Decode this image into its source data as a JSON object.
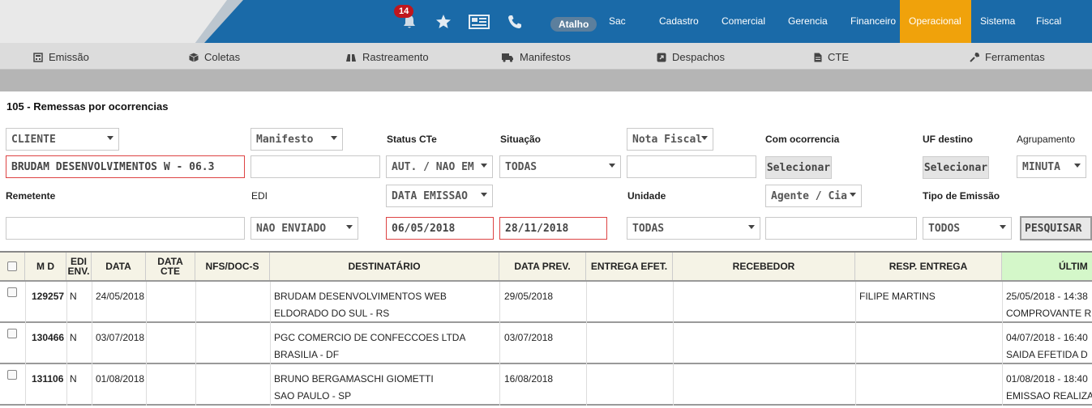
{
  "header": {
    "notification_count": "14",
    "atalho_label": "Atalho",
    "nav": [
      {
        "label": "Sac"
      },
      {
        "label": "Cadastro"
      },
      {
        "label": "Comercial"
      },
      {
        "label": "Gerencia"
      },
      {
        "label": "Financeiro"
      },
      {
        "label": "Operacional",
        "active": true
      },
      {
        "label": "Sistema"
      },
      {
        "label": "Fiscal"
      }
    ],
    "accent_color": "#f0a20b",
    "bar_color": "#1a6aa8"
  },
  "subnav": {
    "items": [
      {
        "label": "Emissão",
        "icon": "calculator-icon"
      },
      {
        "label": "Coletas",
        "icon": "box-icon"
      },
      {
        "label": "Rastreamento",
        "icon": "binoculars-icon"
      },
      {
        "label": "Manifestos",
        "icon": "truck-icon"
      },
      {
        "label": "Despachos",
        "icon": "external-link-icon"
      },
      {
        "label": "CTE",
        "icon": "file-icon"
      },
      {
        "label": "Ferramentas",
        "icon": "wrench-icon"
      }
    ]
  },
  "form": {
    "title": "105 - Remessas por ocorrencias",
    "cliente_select": "CLIENTE",
    "cliente_value": "BRUDAM DESENVOLVIMENTOS W - 06.3",
    "manifesto_select": "Manifesto",
    "manifesto_value": "",
    "status_cte_label": "Status CTe",
    "status_cte_value": "AUT. / NAO EM",
    "situacao_label": "Situação",
    "situacao_value": "TODAS",
    "nota_fiscal_select": "Nota Fiscal",
    "nota_fiscal_value": "",
    "com_ocorrencia_label": "Com ocorrencia",
    "selecionar_label": "Selecionar",
    "uf_destino_label": "UF destino",
    "agrupamento_label": "Agrupamento",
    "agrupamento_value": "MINUTA",
    "remetente_label": "Remetente",
    "remetente_value": "",
    "edi_label": "EDI",
    "edi_value": "NAO ENVIADO",
    "data_tipo_value": "DATA EMISSAO",
    "data_inicio": "06/05/2018",
    "data_fim": "28/11/2018",
    "unidade_label": "Unidade",
    "unidade_value": "TODAS",
    "agente_select": "Agente / Cia",
    "agente_value": "",
    "tipo_emissao_label": "Tipo de Emissão",
    "tipo_emissao_value": "TODOS",
    "pesquisar_label": "PESQUISAR"
  },
  "table": {
    "headers": {
      "md": "M D",
      "edi_1": "EDI",
      "edi_2": "ENV.",
      "data": "DATA",
      "data_cte_1": "DATA",
      "data_cte_2": "CTE",
      "nfs": "NFS/DOC-S",
      "destinatario": "DESTINATÁRIO",
      "data_prev": "DATA PREV.",
      "entrega": "ENTREGA EFET.",
      "recebedor": "RECEBEDOR",
      "resp": "RESP. ENTREGA",
      "ultima": "ÚLTIM"
    },
    "rows": [
      {
        "md": "129257",
        "edi": "N",
        "data": "24/05/2018",
        "data_cte": "",
        "nfs": "",
        "dest_nome": "BRUDAM DESENVOLVIMENTOS WEB",
        "dest_cidade": "ELDORADO DO SUL - RS",
        "data_prev": "29/05/2018",
        "entrega": "",
        "recebedor": "",
        "resp": "FILIPE MARTINS",
        "ult_data": "25/05/2018 - 14:38",
        "ult_desc": "COMPROVANTE R"
      },
      {
        "md": "130466",
        "edi": "N",
        "data": "03/07/2018",
        "data_cte": "",
        "nfs": "",
        "dest_nome": "PGC COMERCIO DE CONFECCOES LTDA",
        "dest_cidade": "BRASILIA - DF",
        "data_prev": "03/07/2018",
        "entrega": "",
        "recebedor": "",
        "resp": "",
        "ult_data": "04/07/2018 - 16:40",
        "ult_desc": "SAIDA EFETIDA D"
      },
      {
        "md": "131106",
        "edi": "N",
        "data": "01/08/2018",
        "data_cte": "",
        "nfs": "",
        "dest_nome": "BRUNO BERGAMASCHI GIOMETTI",
        "dest_cidade": "SAO PAULO - SP",
        "data_prev": "16/08/2018",
        "entrega": "",
        "recebedor": "",
        "resp": "",
        "ult_data": "01/08/2018 - 18:40",
        "ult_desc": "EMISSAO REALIZA"
      }
    ]
  }
}
